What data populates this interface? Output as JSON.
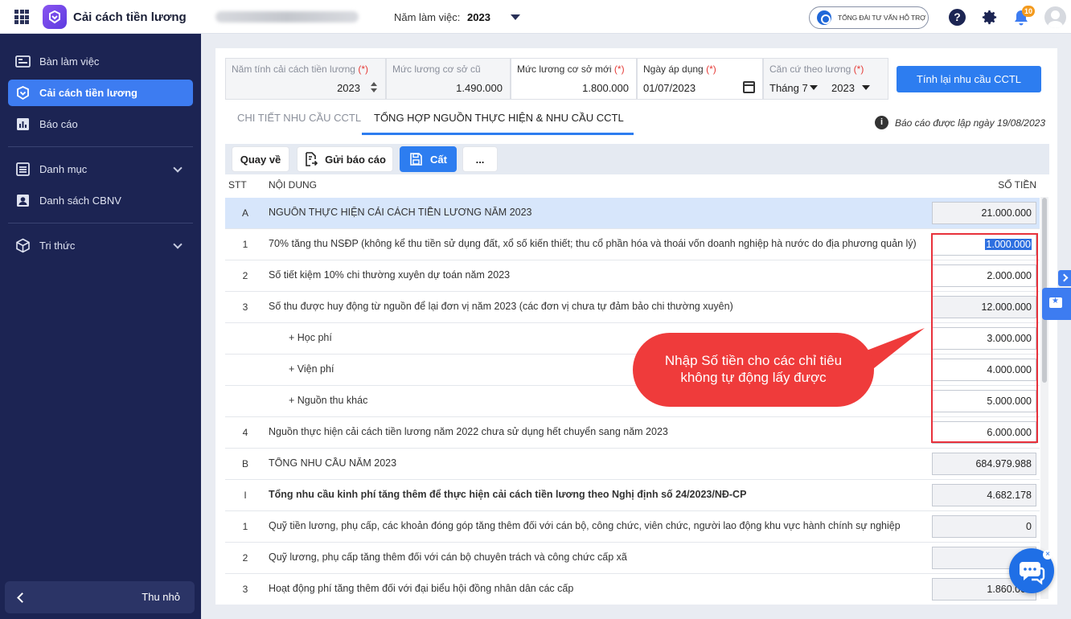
{
  "app": {
    "title": "Cải cách tiền lương",
    "year_label": "Năm làm việc:",
    "year_value": "2023",
    "support_label": "TỔNG ĐÀI TƯ VẤN HỖ TRỢ",
    "notification_count": "10"
  },
  "sidebar": {
    "items": [
      {
        "label": "Bàn làm việc",
        "icon": "dashboard-icon"
      },
      {
        "label": "Cải cách tiền lương",
        "icon": "app-logo-icon",
        "active": true
      },
      {
        "label": "Báo cáo",
        "icon": "bar-chart-icon"
      },
      {
        "label": "Danh mục",
        "icon": "list-icon",
        "expandable": true
      },
      {
        "label": "Danh sách CBNV",
        "icon": "person-card-icon"
      },
      {
        "label": "Tri thức",
        "icon": "cube-icon",
        "expandable": true
      }
    ],
    "collapse_label": "Thu nhỏ"
  },
  "form": {
    "reform_year": {
      "label": "Năm tính cải cách tiền lương",
      "required": "(*)",
      "value": "2023"
    },
    "old_base": {
      "label": "Mức lương cơ sở cũ",
      "value": "1.490.000"
    },
    "new_base": {
      "label": "Mức lương cơ sở mới",
      "required": "(*)",
      "value": "1.800.000"
    },
    "apply_date": {
      "label": "Ngày áp dụng",
      "required": "(*)",
      "value": "01/07/2023"
    },
    "basis": {
      "label": "Căn cứ theo lương",
      "required": "(*)",
      "month": "Tháng 7",
      "year": "2023"
    },
    "recalc_label": "Tính lại nhu cầu CCTL"
  },
  "tabs": [
    {
      "label": "CHI TIẾT NHU CẦU CCTL",
      "active": false
    },
    {
      "label": "TỔNG HỢP NGUỒN THỰC HIỆN & NHU CẦU CCTL",
      "active": true
    }
  ],
  "report_note": "Báo cáo được lập ngày 19/08/2023",
  "toolbar": {
    "back_label": "Quay về",
    "send_label": "Gửi báo cáo",
    "save_label": "Cất",
    "more_label": "..."
  },
  "table": {
    "headers": {
      "stt": "STT",
      "content": "NỘI DUNG",
      "amount": "SỐ TIỀN"
    },
    "rows": [
      {
        "stt": "A",
        "content": "NGUỒN THỰC HIỆN CẢI CÁCH TIỀN LƯƠNG NĂM 2023",
        "amount": "21.000.000",
        "section": true
      },
      {
        "stt": "1",
        "content": "70% tăng thu NSĐP (không kể thu tiền sử dụng đất, xổ số kiến thiết; thu cổ phần hóa và thoái vốn doanh nghiệp hà nước do địa phương quản lý)",
        "amount": "1.000.000",
        "editable": true,
        "selected": true
      },
      {
        "stt": "2",
        "content": "Số tiết kiệm 10% chi thường xuyên dự toán năm 2023",
        "amount": "2.000.000",
        "editable": true
      },
      {
        "stt": "3",
        "content": "Số thu được huy động từ nguồn để lại đơn vị năm 2023 (các đơn vị chưa tự đảm bảo chi thường xuyên)",
        "amount": "12.000.000"
      },
      {
        "stt": "",
        "content": "+ Học phí",
        "amount": "3.000.000",
        "editable": true,
        "sub": true
      },
      {
        "stt": "",
        "content": "+ Viện phí",
        "amount": "4.000.000",
        "editable": true,
        "sub": true
      },
      {
        "stt": "",
        "content": "+ Nguồn thu khác",
        "amount": "5.000.000",
        "editable": true,
        "sub": true
      },
      {
        "stt": "4",
        "content": "Nguồn thực hiện cải cách tiền lương năm 2022 chưa sử dụng hết chuyển sang năm 2023",
        "amount": "6.000.000",
        "editable": true
      },
      {
        "stt": "B",
        "content": "TỔNG NHU CẦU NĂM 2023",
        "amount": "684.979.988"
      },
      {
        "stt": "I",
        "content": "Tổng nhu cầu kinh phí tăng thêm để thực hiện cải cách tiền lương theo Nghị định số 24/2023/NĐ-CP",
        "amount": "4.682.178",
        "bold": true
      },
      {
        "stt": "1",
        "content": "Quỹ tiền lương, phụ cấp, các khoản đóng góp tăng thêm đối với cán bộ, công chức, viên chức, người lao động khu vực hành chính sự nghiệp",
        "amount": "0"
      },
      {
        "stt": "2",
        "content": "Quỹ lương, phụ cấp tăng thêm đối với cán bộ chuyên trách và công chức cấp xã",
        "amount": ""
      },
      {
        "stt": "3",
        "content": "Hoạt động phí tăng thêm đối với đại biểu hội đồng nhân dân các cấp",
        "amount": "1.860.000"
      }
    ]
  },
  "callout_text": "Nhập Số tiền cho các chỉ tiêu không tự động lấy được",
  "colors": {
    "primary": "#2d7df0",
    "sidebar": "#1c2453",
    "callout": "#ef3b3b"
  }
}
